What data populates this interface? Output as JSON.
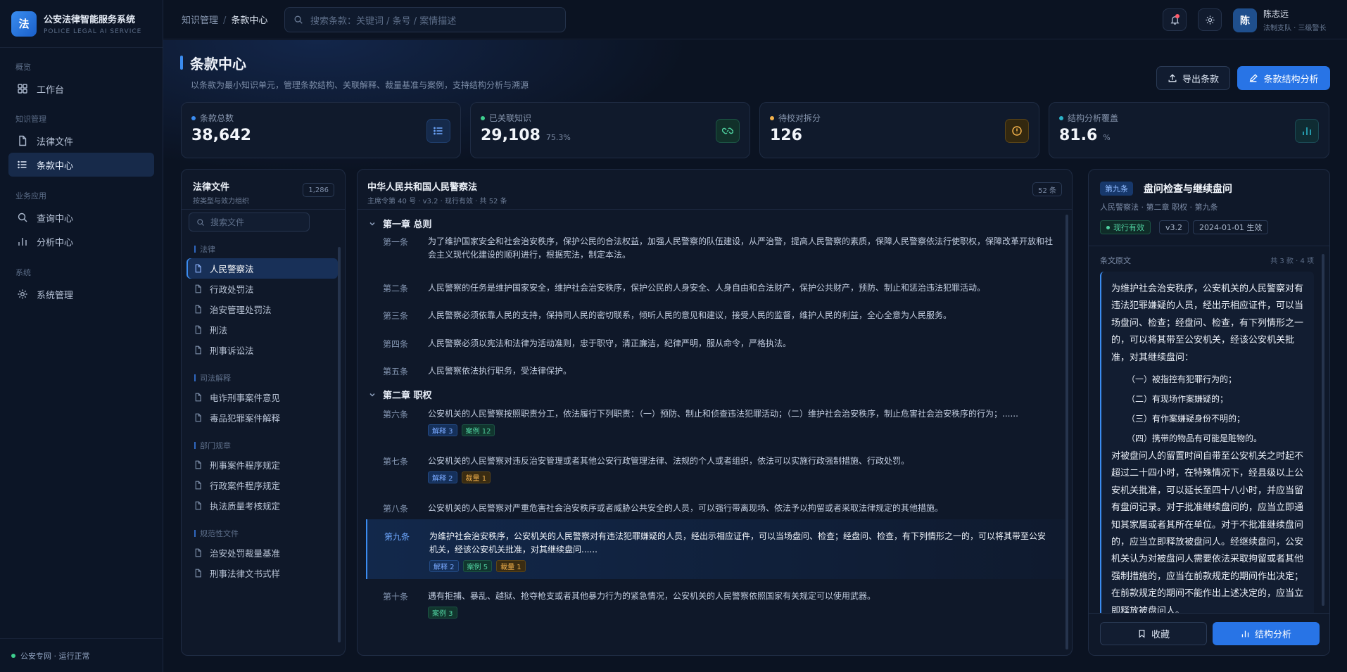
{
  "brand": {
    "logo": "法",
    "name": "公安法律智能服务系统",
    "sub": "POLICE LEGAL AI SERVICE"
  },
  "nav": {
    "groups": [
      {
        "label": "概览",
        "items": [
          {
            "label": "工作台",
            "icon": "dashboard-icon"
          }
        ]
      },
      {
        "label": "知识管理",
        "items": [
          {
            "label": "法律文件",
            "icon": "document-icon"
          },
          {
            "label": "条款中心",
            "icon": "list-icon",
            "active": true
          }
        ]
      },
      {
        "label": "业务应用",
        "items": [
          {
            "label": "查询中心",
            "icon": "search-icon"
          },
          {
            "label": "分析中心",
            "icon": "bar-chart-icon"
          }
        ]
      },
      {
        "label": "系统",
        "items": [
          {
            "label": "系统管理",
            "icon": "gear-icon"
          }
        ]
      }
    ],
    "status": "公安专网 · 运行正常"
  },
  "topbar": {
    "breadcrumb": [
      "知识管理",
      "条款中心"
    ],
    "search_placeholder": "搜索条款：关键词 / 条号 / 案情描述",
    "user": {
      "avatar": "陈",
      "name": "陈志远",
      "role": "法制支队 · 三级警长"
    }
  },
  "page": {
    "title": "条款中心",
    "desc": "以条款为最小知识单元，管理条款结构、关联解释、裁量基准与案例，支持结构分析与溯源",
    "export_label": "导出条款",
    "analyze_label": "条款结构分析"
  },
  "stats": [
    {
      "label": "条款总数",
      "value": "38,642",
      "sub": "",
      "color": "#3b8cf0",
      "icon": "list-icon"
    },
    {
      "label": "已关联知识",
      "value": "29,108",
      "sub": "75.3%",
      "color": "#3ecf8e",
      "icon": "link-icon"
    },
    {
      "label": "待校对拆分",
      "value": "126",
      "sub": "",
      "color": "#f2b14b",
      "icon": "alert-icon"
    },
    {
      "label": "结构分析覆盖",
      "value": "81.6",
      "sub": "%",
      "color": "#2bb3c9",
      "icon": "bar-chart-icon"
    }
  ],
  "files": {
    "title": "法律文件",
    "sub": "按类型与效力组织",
    "count": "1,286",
    "search_placeholder": "搜索文件",
    "groups": [
      {
        "label": "法律",
        "items": [
          {
            "label": "人民警察法",
            "active": true
          },
          {
            "label": "行政处罚法"
          },
          {
            "label": "治安管理处罚法"
          },
          {
            "label": "刑法"
          },
          {
            "label": "刑事诉讼法"
          }
        ]
      },
      {
        "label": "司法解释",
        "items": [
          {
            "label": "电诈刑事案件意见"
          },
          {
            "label": "毒品犯罪案件解释"
          }
        ]
      },
      {
        "label": "部门规章",
        "items": [
          {
            "label": "刑事案件程序规定"
          },
          {
            "label": "行政案件程序规定"
          },
          {
            "label": "执法质量考核规定"
          }
        ]
      },
      {
        "label": "规范性文件",
        "items": [
          {
            "label": "治安处罚裁量基准"
          },
          {
            "label": "刑事法律文书式样"
          }
        ]
      }
    ]
  },
  "law": {
    "title": "中华人民共和国人民警察法",
    "meta": "主席令第 40 号 · v3.2 · 现行有效 · 共 52 条",
    "count": "52 条",
    "chapters": [
      {
        "title": "第一章 总则",
        "articles": [
          {
            "no": "第一条",
            "text": "为了维护国家安全和社会治安秩序，保护公民的合法权益，加强人民警察的队伍建设，从严治警，提高人民警察的素质，保障人民警察依法行使职权，保障改革开放和社会主义现代化建设的顺利进行，根据宪法，制定本法。",
            "tags": []
          },
          {
            "no": "第二条",
            "text": "人民警察的任务是维护国家安全，维护社会治安秩序，保护公民的人身安全、人身自由和合法财产，保护公共财产，预防、制止和惩治违法犯罪活动。",
            "tags": []
          },
          {
            "no": "第三条",
            "text": "人民警察必须依靠人民的支持，保持同人民的密切联系，倾听人民的意见和建议，接受人民的监督，维护人民的利益，全心全意为人民服务。",
            "tags": []
          },
          {
            "no": "第四条",
            "text": "人民警察必须以宪法和法律为活动准则，忠于职守，清正廉洁，纪律严明，服从命令，严格执法。",
            "tags": []
          },
          {
            "no": "第五条",
            "text": "人民警察依法执行职务，受法律保护。",
            "tags": []
          }
        ]
      },
      {
        "title": "第二章 职权",
        "articles": [
          {
            "no": "第六条",
            "text": "公安机关的人民警察按照职责分工，依法履行下列职责：（一）预防、制止和侦查违法犯罪活动；（二）维护社会治安秩序，制止危害社会治安秩序的行为；......",
            "tags": [
              {
                "label": "解释 3",
                "kind": "blue"
              },
              {
                "label": "案例 12",
                "kind": "green"
              }
            ]
          },
          {
            "no": "第七条",
            "text": "公安机关的人民警察对违反治安管理或者其他公安行政管理法律、法规的个人或者组织，依法可以实施行政强制措施、行政处罚。",
            "tags": [
              {
                "label": "解释 2",
                "kind": "blue"
              },
              {
                "label": "裁量 1",
                "kind": "amber"
              }
            ]
          },
          {
            "no": "第八条",
            "text": "公安机关的人民警察对严重危害社会治安秩序或者威胁公共安全的人员，可以强行带离现场、依法予以拘留或者采取法律规定的其他措施。",
            "tags": []
          },
          {
            "no": "第九条",
            "text": "为维护社会治安秩序，公安机关的人民警察对有违法犯罪嫌疑的人员，经出示相应证件，可以当场盘问、检查；经盘问、检查，有下列情形之一的，可以将其带至公安机关，经该公安机关批准，对其继续盘问......",
            "selected": true,
            "tags": [
              {
                "label": "解释 2",
                "kind": "blue"
              },
              {
                "label": "案例 5",
                "kind": "green"
              },
              {
                "label": "裁量 1",
                "kind": "amber"
              }
            ]
          },
          {
            "no": "第十条",
            "text": "遇有拒捕、暴乱、越狱、抢夺枪支或者其他暴力行为的紧急情况，公安机关的人民警察依照国家有关规定可以使用武器。",
            "tags": [
              {
                "label": "案例 3",
                "kind": "green"
              }
            ]
          }
        ]
      }
    ]
  },
  "detail": {
    "no": "第九条",
    "title": "盘问检查与继续盘问",
    "crumb": "人民警察法 · 第二章 职权 · 第九条",
    "chips": [
      "现行有效",
      "v3.2",
      "2024-01-01 生效"
    ],
    "section_label": "条文原文",
    "section_meta": "共 3 款 · 4 项",
    "paragraph1": "为维护社会治安秩序，公安机关的人民警察对有违法犯罪嫌疑的人员，经出示相应证件，可以当场盘问、检查；经盘问、检查，有下列情形之一的，可以将其带至公安机关，经该公安机关批准，对其继续盘问：",
    "items": [
      "（一）被指控有犯罪行为的；",
      "（二）有现场作案嫌疑的；",
      "（三）有作案嫌疑身份不明的；",
      "（四）携带的物品有可能是赃物的。"
    ],
    "paragraph2": "对被盘问人的留置时间自带至公安机关之时起不超过二十四小时，在特殊情况下，经县级以上公安机关批准，可以延长至四十八小时，并应当留有盘问记录。对于批准继续盘问的，应当立即通知其家属或者其所在单位。对于不批准继续盘问的，应当立即释放被盘问人。经继续盘问，公安机关认为对被盘问人需要依法采取拘留或者其他强制措施的，应当在前款规定的期间作出决定；在前款规定的期间不能作出上述决定的，应当立即释放被盘问人。",
    "fav_label": "收藏",
    "analyze_label": "结构分析"
  },
  "colors": {
    "accent": "#2874e6",
    "success": "#3ecf8e",
    "warning": "#f2b14b",
    "background": "#0b1322"
  }
}
